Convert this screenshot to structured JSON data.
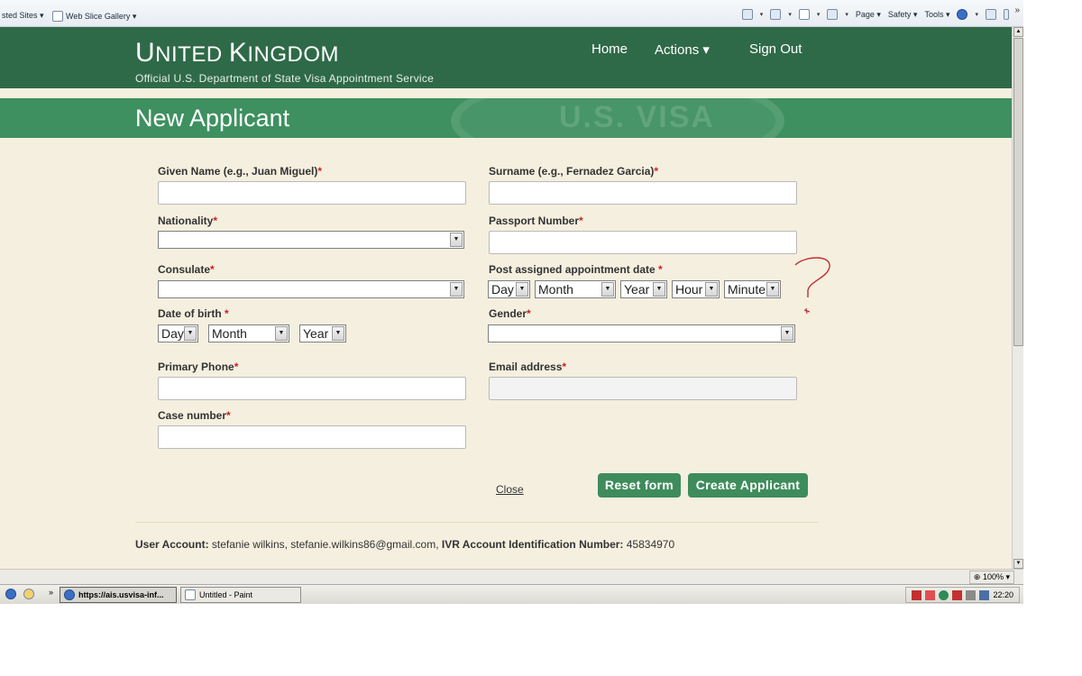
{
  "browser": {
    "favorites": [
      {
        "label": "sted Sites ▾"
      },
      {
        "label": "Web Slice Gallery ▾"
      }
    ],
    "command_bar": {
      "page": "Page ▾",
      "safety": "Safety ▾",
      "tools": "Tools ▾"
    },
    "zoom": "100%"
  },
  "header": {
    "title_u": "U",
    "title_nited": "NITED ",
    "title_k": "K",
    "title_ingdom": "INGDOM",
    "subtitle": "Official U.S. Department of State Visa Appointment Service",
    "nav": {
      "home": "Home",
      "actions": "Actions ▾",
      "sign_out": "Sign Out"
    },
    "watermark": "U.S. VISA"
  },
  "page_title": "New Applicant",
  "form": {
    "given_name_label": "Given Name (e.g., Juan Miguel)",
    "surname_label": "Surname (e.g., Fernadez Garcia)",
    "nationality_label": "Nationality",
    "passport_label": "Passport Number",
    "consulate_label": "Consulate",
    "post_date_label": "Post assigned appointment date ",
    "dob_label": "Date of birth ",
    "gender_label": "Gender",
    "phone_label": "Primary Phone",
    "email_label": "Email address",
    "case_label": "Case number",
    "required_mark": "*",
    "post_date": {
      "day": "Day",
      "month": "Month",
      "year": "Year",
      "hour": "Hour",
      "minute": "Minute"
    },
    "dob": {
      "day": "Day",
      "month": "Month",
      "year": "Year"
    }
  },
  "actions": {
    "close": "Close",
    "reset": "Reset form",
    "create": "Create Applicant"
  },
  "account": {
    "label": "User Account:",
    "value": " stefanie wilkins, stefanie.wilkins86@gmail.com, ",
    "ivr_label": "IVR Account Identification Number:",
    "ivr_value": " 45834970"
  },
  "taskbar": {
    "ie_task": "https://ais.usvisa-inf...",
    "paint_task": "Untitled - Paint",
    "time": "22:20"
  },
  "colors": {
    "header": "#2f6a48",
    "band": "#3e9060",
    "button": "#3e8c5c",
    "page_bg": "#f5efdf"
  }
}
